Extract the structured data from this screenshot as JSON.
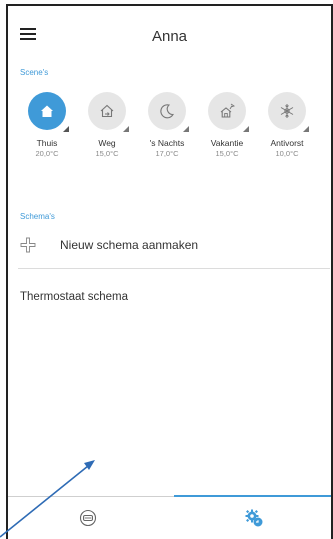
{
  "header": {
    "title": "Anna"
  },
  "scenes": {
    "label": "Scene's",
    "items": [
      {
        "name": "Thuis",
        "temp": "20,0°C",
        "icon": "home-icon",
        "active": true
      },
      {
        "name": "Weg",
        "temp": "15,0°C",
        "icon": "away-house-icon",
        "active": false
      },
      {
        "name": "'s Nachts",
        "temp": "17,0°C",
        "icon": "moon-icon",
        "active": false
      },
      {
        "name": "Vakantie",
        "temp": "15,0°C",
        "icon": "vacation-house-icon",
        "active": false
      },
      {
        "name": "Antivorst",
        "temp": "10,0°C",
        "icon": "snowflake-icon",
        "active": false
      }
    ]
  },
  "schemas": {
    "label": "Schema's",
    "new_label": "Nieuw schema aanmaken",
    "items": [
      "Thermostaat schema"
    ]
  },
  "colors": {
    "accent": "#3f9ad8",
    "arrow": "#2e6bb5"
  },
  "nav": {
    "tabs": [
      {
        "icon": "thermostat-icon"
      },
      {
        "icon": "gear-icon",
        "active": true
      }
    ]
  }
}
